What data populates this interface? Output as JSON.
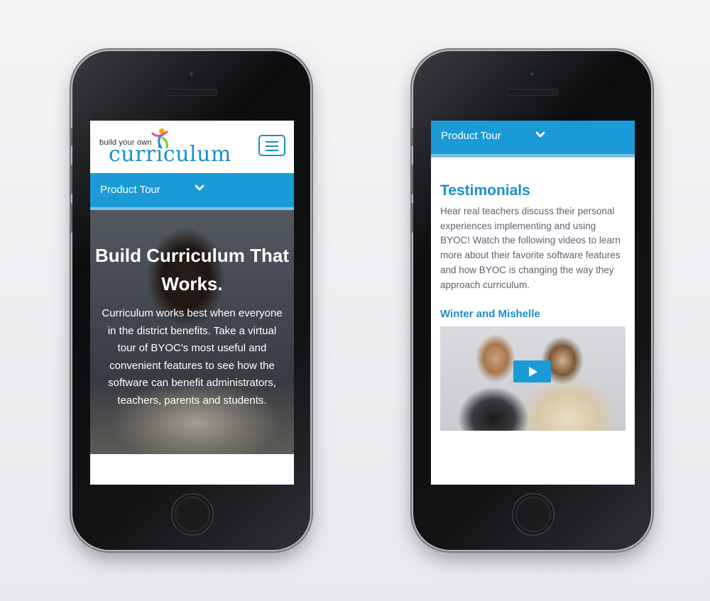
{
  "left_phone": {
    "logo_small": "build your own",
    "logo_big": "curriculum",
    "nav_label": "Product Tour",
    "hero_title": "Build Curriculum That Works.",
    "hero_text": "Curriculum works best when everyone in the district benefits. Take a virtual tour of BYOC's most useful and convenient features to see how the software can benefit administrators, teachers, parents and students."
  },
  "right_phone": {
    "nav_label": "Product Tour",
    "section_title": "Testimonials",
    "section_text": "Hear real teachers discuss their personal experiences implementing and using BYOC! Watch the following videos to learn more about their favorite software features and how BYOC is changing the way they approach curriculum.",
    "video_title": "Winter and Mishelle"
  },
  "colors": {
    "brand_blue": "#1a9ad6",
    "accent_light_blue": "#7bc4e8",
    "text_gray": "#5b6470"
  },
  "icons": [
    "hamburger-menu-icon",
    "chevron-down-icon",
    "play-icon"
  ]
}
